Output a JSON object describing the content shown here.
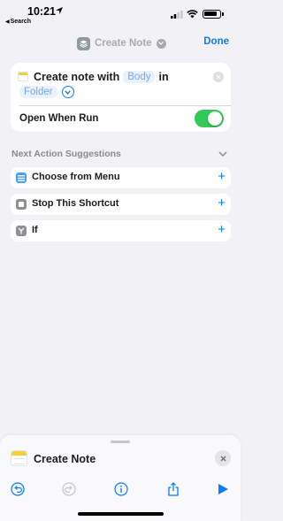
{
  "status_bar": {
    "time": "10:21",
    "back_app": "Search"
  },
  "nav": {
    "title": "Create Note",
    "done_label": "Done"
  },
  "action": {
    "prefix": "Create note with",
    "body_token": "Body",
    "in_word": "in",
    "folder_token": "Folder",
    "option_label": "Open When Run",
    "option_enabled": true
  },
  "suggestions": {
    "header": "Next Action Suggestions",
    "items": [
      {
        "label": "Choose from Menu",
        "icon": "menu-list-icon",
        "color": "#4a9ef5"
      },
      {
        "label": "Stop This Shortcut",
        "icon": "stop-icon",
        "color": "#8e8e93"
      },
      {
        "label": "If",
        "icon": "branch-icon",
        "color": "#8e8e93"
      }
    ]
  },
  "sheet": {
    "title": "Create Note",
    "toolbar": [
      "undo-icon",
      "redo-icon",
      "info-icon",
      "share-icon",
      "play-icon"
    ]
  },
  "colors": {
    "accent": "#0a7aff",
    "toggle_on": "#34c759",
    "background": "#f2f2f6"
  }
}
